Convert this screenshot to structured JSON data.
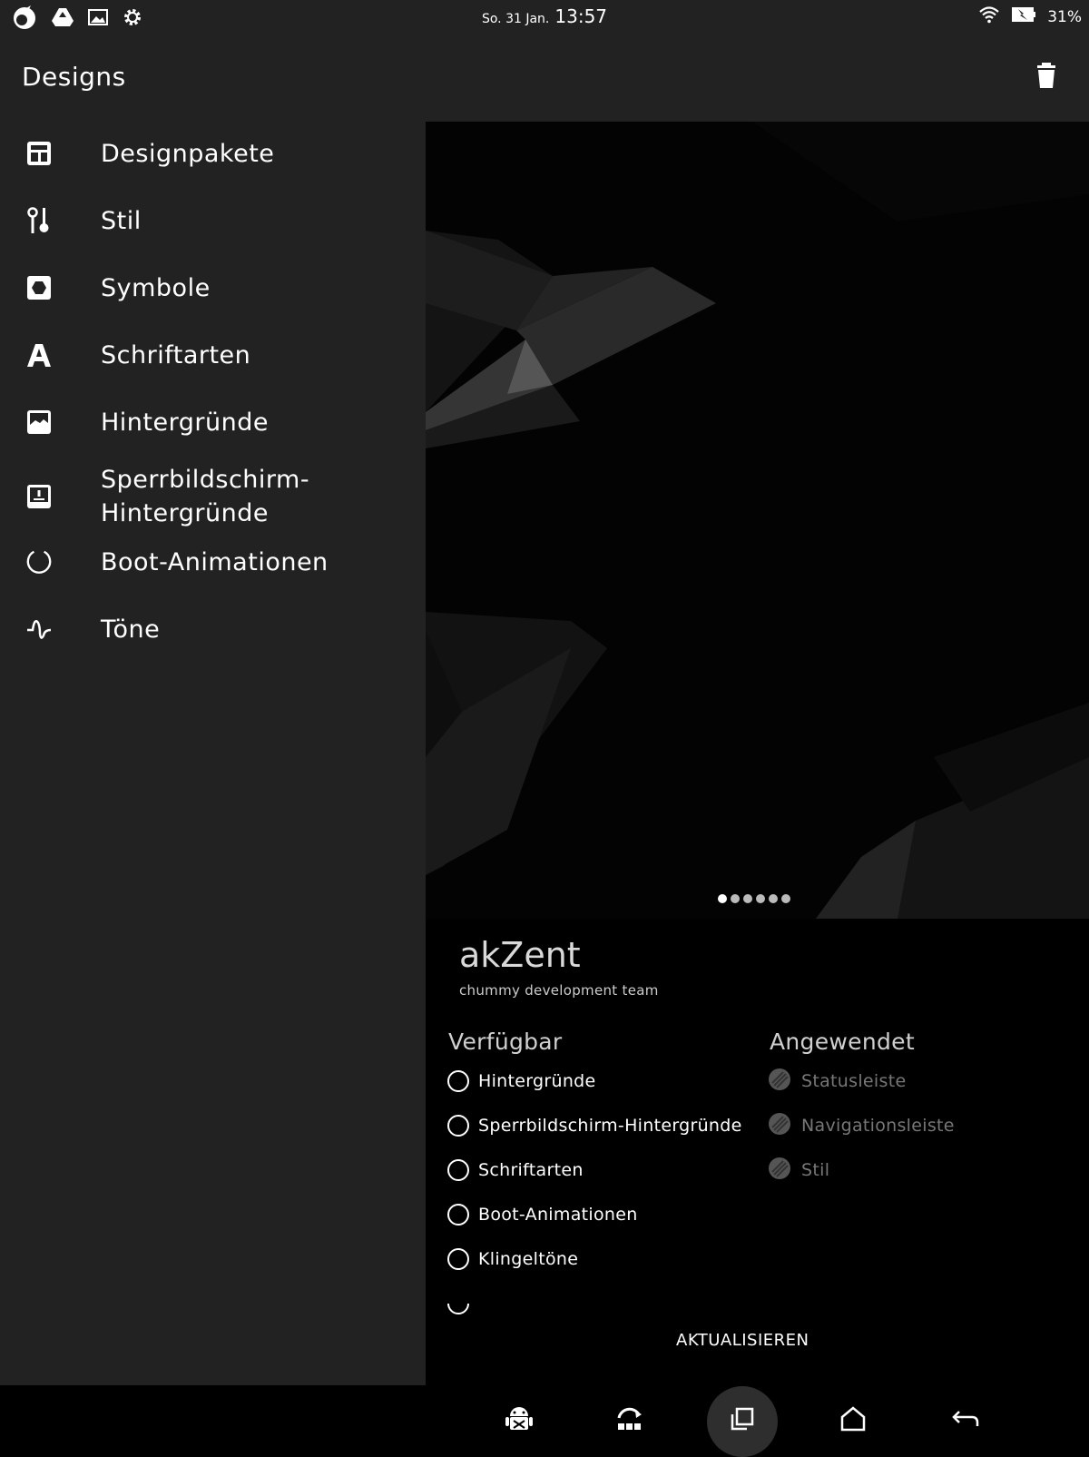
{
  "status_bar": {
    "date": "So. 31 Jan.",
    "time": "13:57",
    "battery": "31%",
    "left_icons": [
      "unicorn-icon",
      "drive-icon",
      "image-icon",
      "gear-icon"
    ],
    "right_icons": [
      "wifi-icon",
      "battery-icon"
    ]
  },
  "app_bar": {
    "title": "Designs",
    "action_icon": "trash-icon"
  },
  "drawer": {
    "items": [
      {
        "label": "Designpakete",
        "icon": "theme-pack-icon"
      },
      {
        "label": "Stil",
        "icon": "style-icon"
      },
      {
        "label": "Symbole",
        "icon": "icons-icon"
      },
      {
        "label": "Schriftarten",
        "icon": "font-icon"
      },
      {
        "label": "Hintergründe",
        "icon": "wallpaper-icon"
      },
      {
        "label": "Sperrbildschirm-\nHintergründe",
        "icon": "lockscreen-wallpaper-icon"
      },
      {
        "label": "Boot-Animationen",
        "icon": "boot-animation-icon"
      },
      {
        "label": "Töne",
        "icon": "sounds-icon"
      }
    ]
  },
  "preview": {
    "page_count": 6,
    "active_page": 1
  },
  "theme": {
    "name": "akZent",
    "author": "chummy development team"
  },
  "available": {
    "heading": "Verfügbar",
    "options": [
      "Hintergründe",
      "Sperrbildschirm-Hintergründe",
      "Schriftarten",
      "Boot-Animationen",
      "Klingeltöne"
    ]
  },
  "applied": {
    "heading": "Angewendet",
    "options": [
      "Statusleiste",
      "Navigationsleiste",
      "Stil"
    ]
  },
  "actions": {
    "update_label": "AKTUALISIEREN"
  },
  "nav_bar": {
    "buttons": [
      "android-icon",
      "rotate-icon",
      "recents-icon",
      "home-icon",
      "back-icon"
    ]
  }
}
